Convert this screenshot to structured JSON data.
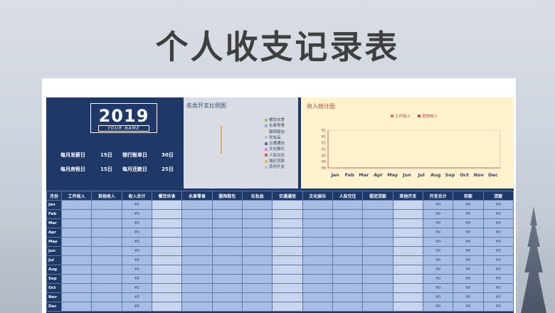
{
  "page_title": "个人收支记录表",
  "year": "2019",
  "your_name": "YOUR NAME",
  "info": {
    "salary_day_label": "每月发薪日",
    "salary_day_value": "15日",
    "bank_bill_label": "银行账单日",
    "bank_bill_value": "30日",
    "rent_day_label": "每月房租日",
    "rent_day_value": "15日",
    "repay_day_label": "每月还款日",
    "repay_day_value": "25日"
  },
  "pie": {
    "title": "各类开支比例图",
    "legend": [
      "餐饮伙食",
      "水果零食",
      "服饰鞋包",
      "化妆品",
      "交通通信",
      "文化娱乐",
      "人际交往",
      "偿还贷款",
      "其他开支"
    ],
    "colors": [
      "#9bc25a",
      "#8faadc",
      "#e8e0c0",
      "#bfbfbf",
      "#4f6fb0",
      "#d48ad4",
      "#e05a4f",
      "#f0b040",
      "#b0c4de"
    ]
  },
  "chart_data": {
    "type": "line",
    "title": "收入统计图",
    "categories": [
      "Jan",
      "Feb",
      "Mar",
      "Apr",
      "May",
      "Jun",
      "Jul",
      "Aug",
      "Sep",
      "Oct",
      "Nov",
      "Dec"
    ],
    "series": [
      {
        "name": "工作收入",
        "values": [
          0,
          0,
          0,
          0,
          0,
          0,
          0,
          0,
          0,
          0,
          0,
          0
        ],
        "color": "#e07a5f"
      },
      {
        "name": "其他收入",
        "values": [
          0,
          0,
          0,
          0,
          0,
          0,
          0,
          0,
          0,
          0,
          0,
          0
        ],
        "color": "#c0504d"
      }
    ],
    "y_ticks": [
      "¥1",
      "¥1",
      "¥1",
      "¥1",
      "¥0",
      "¥0",
      "¥0"
    ],
    "legend_position": "top"
  },
  "table": {
    "headers": [
      "月份",
      "工作收入",
      "其他收入",
      "收入合计",
      "餐饮伙食",
      "水果零食",
      "服饰鞋包",
      "化妆品",
      "交通通信",
      "文化娱乐",
      "人际交往",
      "偿还贷款",
      "其他开支",
      "开支合计",
      "存款",
      "贷款"
    ],
    "months": [
      "Jan",
      "Feb",
      "Mar",
      "Apr",
      "May",
      "Jun",
      "Jul",
      "Aug",
      "Sep",
      "Oct",
      "Nov",
      "Dec"
    ],
    "zero": "¥0"
  }
}
